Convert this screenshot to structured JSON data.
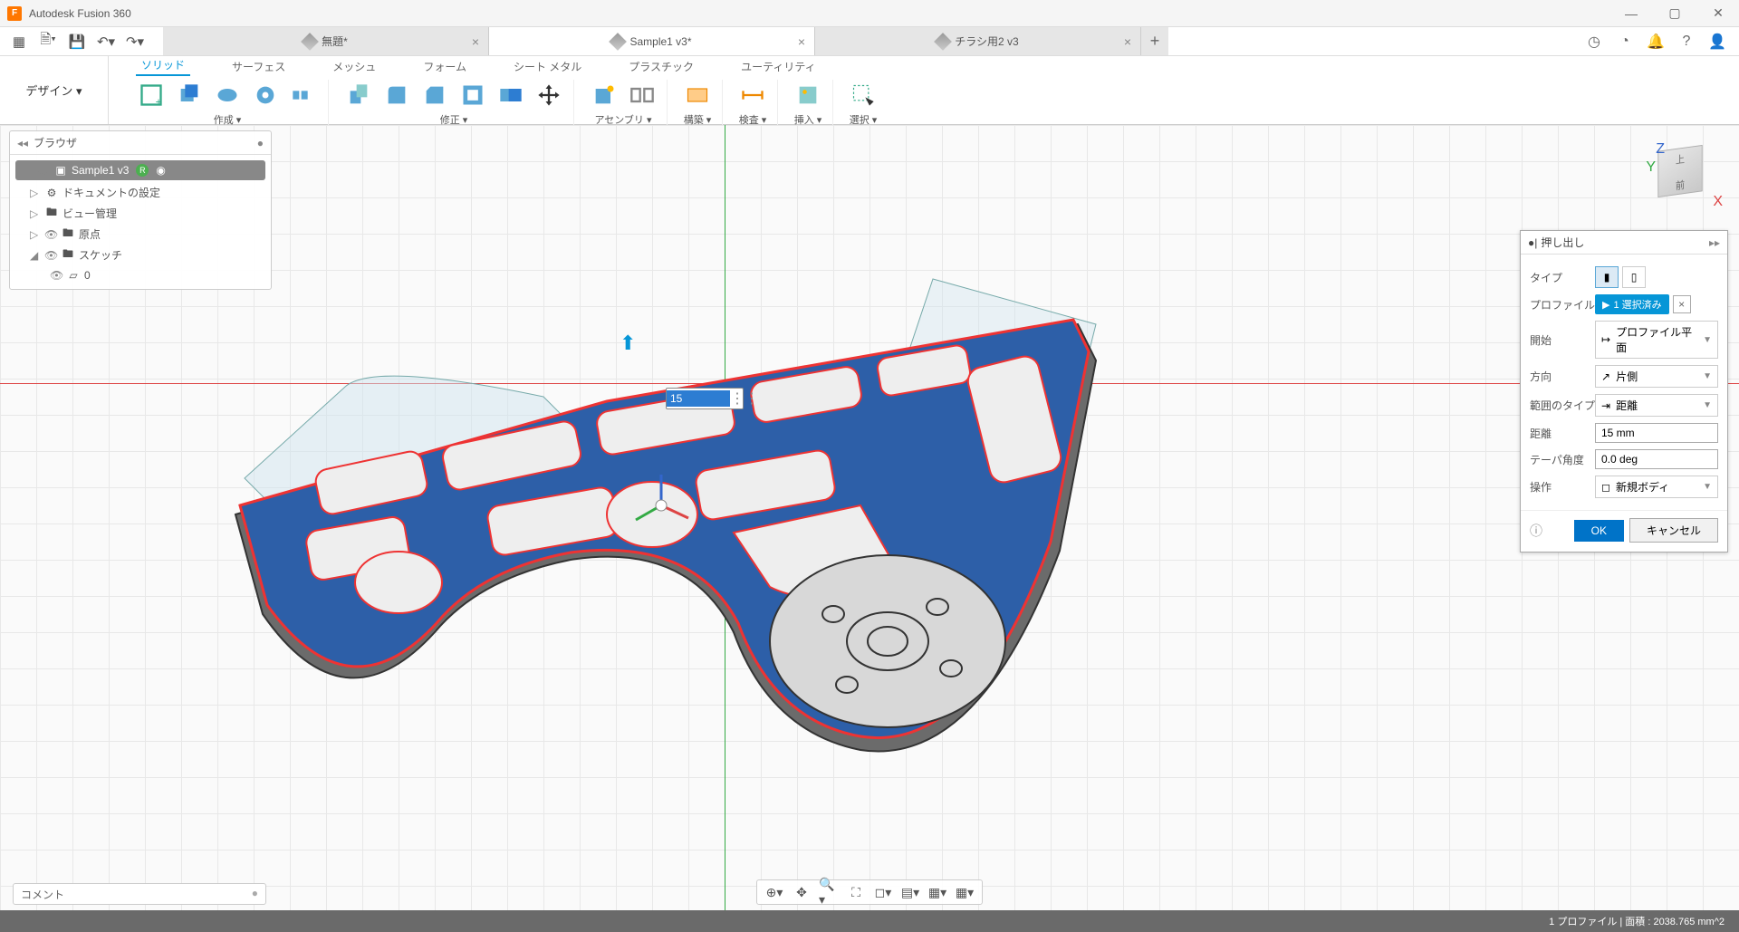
{
  "app": {
    "title": "Autodesk Fusion 360"
  },
  "tabs": [
    {
      "label": "無題*",
      "active": false
    },
    {
      "label": "Sample1 v3*",
      "active": true
    },
    {
      "label": "チラシ用2 v3",
      "active": false
    }
  ],
  "ribbon": {
    "design_button": "デザイン ▾",
    "categories": [
      "ソリッド",
      "サーフェス",
      "メッシュ",
      "フォーム",
      "シート メタル",
      "プラスチック",
      "ユーティリティ"
    ],
    "active_category": "ソリッド",
    "groups": {
      "create": "作成 ▾",
      "modify": "修正 ▾",
      "assembly": "アセンブリ ▾",
      "construct": "構築 ▾",
      "inspect": "検査 ▾",
      "insert": "挿入 ▾",
      "select": "選択 ▾"
    }
  },
  "browser": {
    "title": "ブラウザ",
    "root": "Sample1 v3",
    "nodes": [
      {
        "label": "ドキュメントの設定",
        "icon": "gear"
      },
      {
        "label": "ビュー管理",
        "icon": "folder"
      },
      {
        "label": "原点",
        "icon": "folder"
      },
      {
        "label": "スケッチ",
        "icon": "folder",
        "expanded": true,
        "children": [
          {
            "label": "0",
            "icon": "sketch"
          }
        ]
      }
    ]
  },
  "extrude_dialog": {
    "title": "押し出し",
    "rows": {
      "type": "タイプ",
      "profile": "プロファイル",
      "profile_value": "1 選択済み",
      "start": "開始",
      "start_value": "プロファイル平面",
      "direction": "方向",
      "direction_value": "片側",
      "extent": "範囲のタイプ",
      "extent_value": "距離",
      "distance": "距離",
      "distance_value": "15 mm",
      "taper": "テーパ角度",
      "taper_value": "0.0 deg",
      "operation": "操作",
      "operation_value": "新規ボディ"
    },
    "ok": "OK",
    "cancel": "キャンセル"
  },
  "canvas": {
    "dim_input": "15",
    "viewcube_top": "上",
    "viewcube_front": "前"
  },
  "comment_placeholder": "コメント",
  "status": "1 プロファイル  |  面積 : 2038.765 mm^2"
}
